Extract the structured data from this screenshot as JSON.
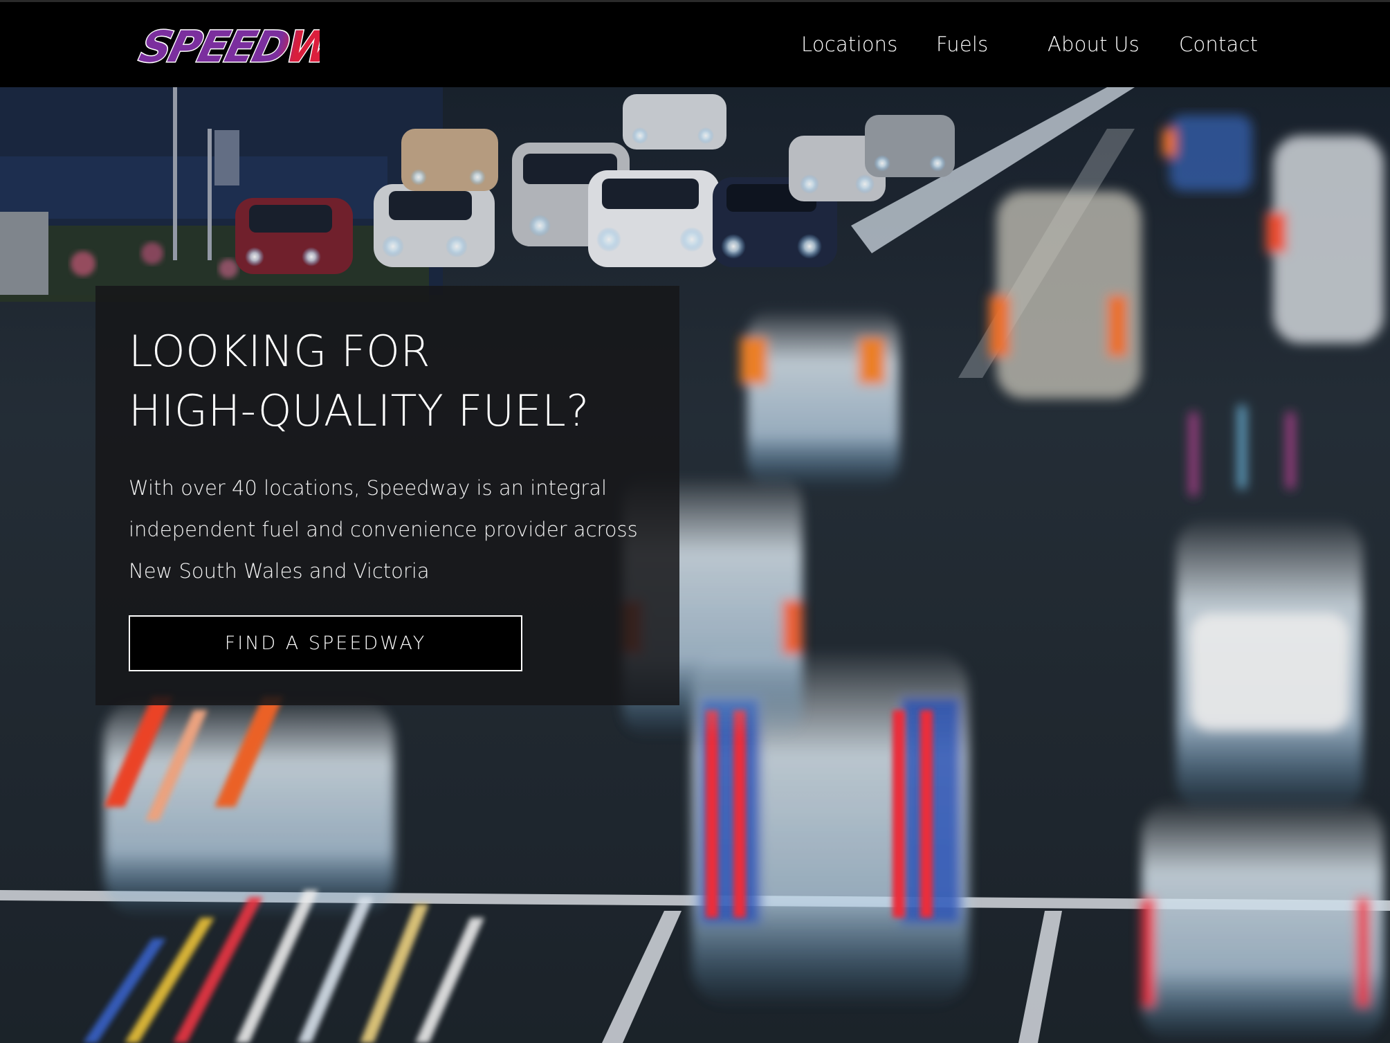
{
  "header": {
    "logo_text": "SPEEDWAY",
    "nav": [
      {
        "label": "Locations"
      },
      {
        "label": "Fuels"
      },
      {
        "label": "About Us"
      },
      {
        "label": "Contact"
      }
    ]
  },
  "hero": {
    "headline_line1": "LOOKING FOR",
    "headline_line2": "HIGH-QUALITY FUEL?",
    "body_line1": "With over 40 locations, Speedway is an integral",
    "body_line2": "independent fuel and convenience provider across",
    "body_line3": "New South Wales and Victoria",
    "cta_label": "FIND A SPEEDWAY"
  },
  "colors": {
    "header_bg": "#000000",
    "logo_fill": "#6a2c91",
    "logo_accent": "#e31c3d",
    "card_bg": "#161618",
    "text": "#ffffff"
  }
}
